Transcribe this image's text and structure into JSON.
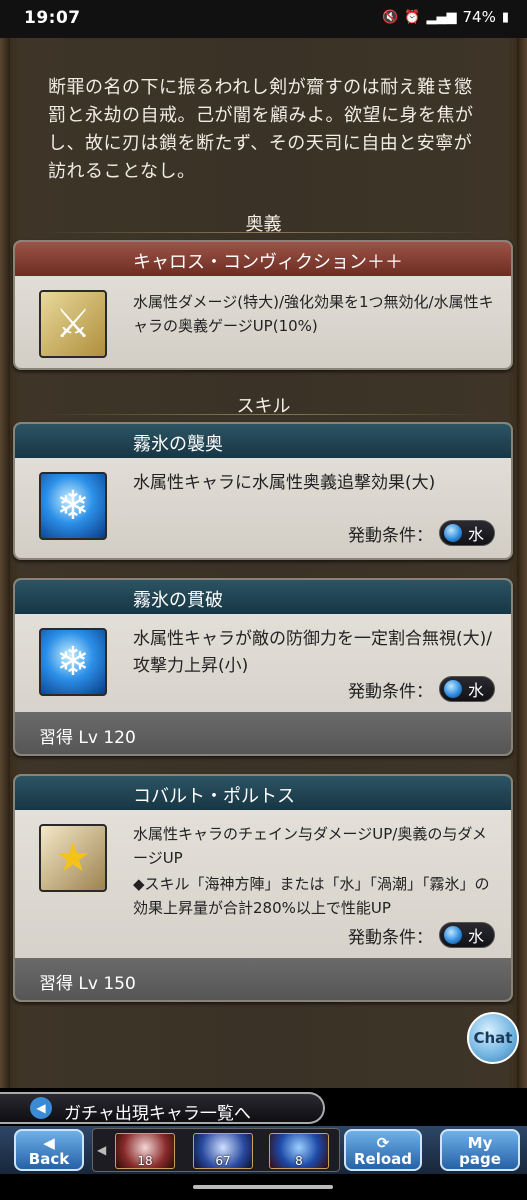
{
  "status": {
    "time": "19:07",
    "battery": "74%"
  },
  "flavor_text": "断罪の名の下に振るわれし剣が齎すのは耐え難き懲罰と永劫の自戒。己が闇を顧みよ。欲望に身を焦がし、故に刃は鎖を断たず、その天司に自由と安寧が訪れることなし。",
  "ougi_section": {
    "title": "奥義",
    "name": "キャロス・コンヴィクション＋＋",
    "description": "水属性ダメージ(特大)/強化効果を1つ無効化/水属性キャラの奥義ゲージUP(10%)",
    "icon": "crossed-swords-icon"
  },
  "skill_section": {
    "title": "スキル",
    "condition_label": "発動条件：",
    "condition_value": "水",
    "skills": [
      {
        "name": "霧氷の襲奥",
        "description": "水属性キャラに水属性奥義追撃効果(大)",
        "learn": ""
      },
      {
        "name": "霧氷の貫破",
        "description": "水属性キャラが敵の防御力を一定割合無視(大)/攻撃力上昇(小)",
        "learn": "習得 Lv 120"
      },
      {
        "name": "コバルト・ポルトス",
        "description1": "水属性キャラのチェイン与ダメージUP/奥義の与ダメージUP",
        "description2": "◆スキル「海神方陣」または「水」「渦潮」「霧氷」の効果上昇量が合計280%以上で性能UP",
        "learn": "習得 Lv 150"
      }
    ]
  },
  "chat_button": "Chat",
  "gacha_bar": "ガチャ出現キャラ一覧へ",
  "navbar": {
    "back": "Back",
    "reload": "Reload",
    "mypage_line1": "My",
    "mypage_line2": "page",
    "thumbs": [
      "18",
      "67",
      "8"
    ]
  }
}
